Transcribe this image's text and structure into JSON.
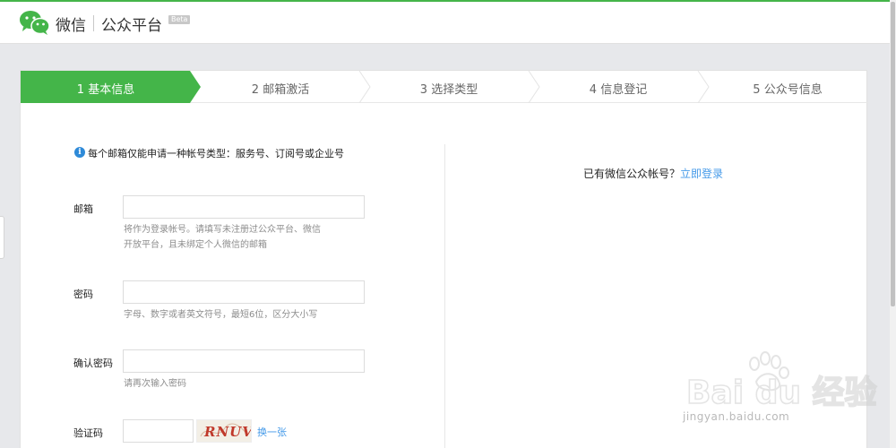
{
  "header": {
    "brand": "微信",
    "platform": "公众平台",
    "beta": "Beta"
  },
  "steps": [
    {
      "label": "1 基本信息",
      "active": true
    },
    {
      "label": "2 邮箱激活",
      "active": false
    },
    {
      "label": "3 选择类型",
      "active": false
    },
    {
      "label": "4 信息登记",
      "active": false
    },
    {
      "label": "5 公众号信息",
      "active": false
    }
  ],
  "form": {
    "tip": "每个邮箱仅能申请一种帐号类型：服务号、订阅号或企业号",
    "email": {
      "label": "邮箱",
      "value": "",
      "hint_line1": "将作为登录帐号。请填写未注册过公众平台、微信",
      "hint_line2": "开放平台，且未绑定个人微信的邮箱"
    },
    "password": {
      "label": "密码",
      "value": "",
      "hint": "字母、数字或者英文符号，最短6位，区分大小写"
    },
    "confirm": {
      "label": "确认密码",
      "value": "",
      "hint": "请再次输入密码"
    },
    "captcha": {
      "label": "验证码",
      "value": "",
      "image_text": "RNUV",
      "refresh": "换一张"
    }
  },
  "login": {
    "prompt": "已有微信公众帐号？",
    "link": "立即登录"
  },
  "watermark": {
    "logo_text": "Bai du 经验",
    "url": "jingyan.baidu.com"
  },
  "colors": {
    "accent": "#44b549",
    "link": "#459ae9",
    "info": "#2e8ad8"
  }
}
